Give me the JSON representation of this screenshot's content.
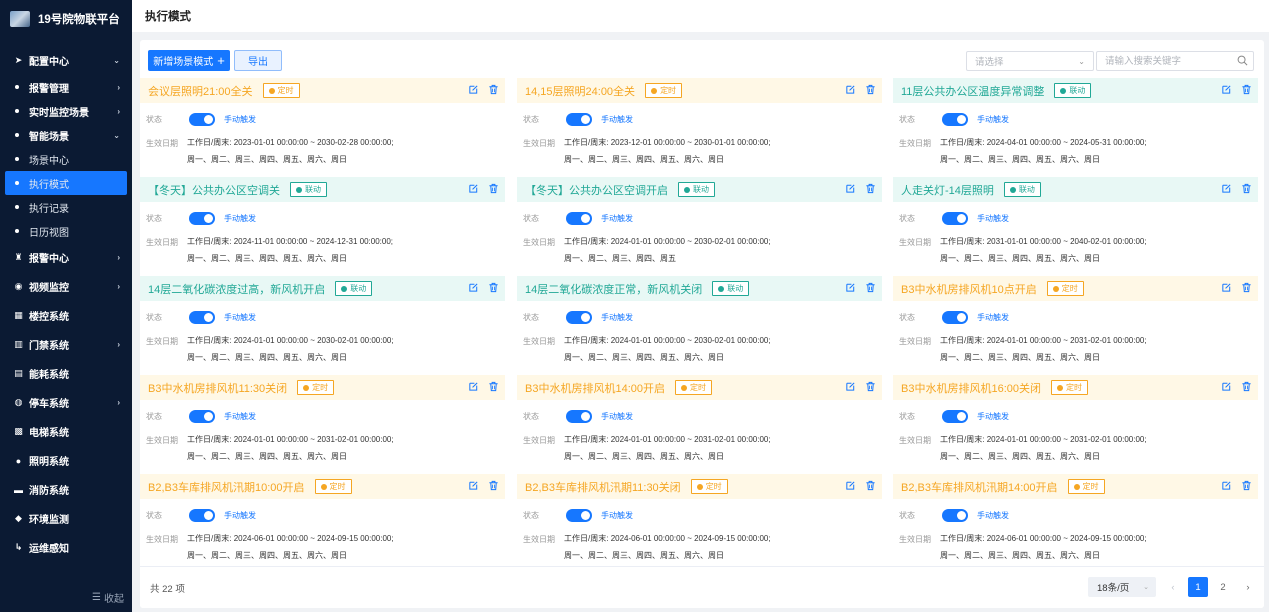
{
  "app": {
    "title": "19号院物联平台"
  },
  "sidebar": {
    "items": [
      {
        "type": "group",
        "label": "配置中心",
        "icon": "send-icon",
        "expanded": true
      },
      {
        "type": "sub",
        "label": "报警管理",
        "arrow": true
      },
      {
        "type": "sub",
        "label": "实时监控场景",
        "arrow": true
      },
      {
        "type": "sub",
        "label": "智能场景",
        "arrow": true,
        "expanded": true
      },
      {
        "type": "leaf",
        "label": "场景中心"
      },
      {
        "type": "leaf",
        "label": "执行模式",
        "active": true
      },
      {
        "type": "leaf",
        "label": "执行记录"
      },
      {
        "type": "leaf",
        "label": "日历视图"
      },
      {
        "type": "group",
        "label": "报警中心",
        "icon": "alarm-icon",
        "arrow": true
      },
      {
        "type": "group",
        "label": "视频监控",
        "icon": "camera-icon",
        "arrow": true
      },
      {
        "type": "group",
        "label": "楼控系统",
        "icon": "building-icon"
      },
      {
        "type": "group",
        "label": "门禁系统",
        "icon": "door-icon",
        "arrow": true
      },
      {
        "type": "group",
        "label": "能耗系统",
        "icon": "energy-icon"
      },
      {
        "type": "group",
        "label": "停车系统",
        "icon": "parking-icon",
        "arrow": true
      },
      {
        "type": "group",
        "label": "电梯系统",
        "icon": "elevator-icon"
      },
      {
        "type": "group",
        "label": "照明系统",
        "icon": "light-icon"
      },
      {
        "type": "group",
        "label": "消防系统",
        "icon": "fire-icon"
      },
      {
        "type": "group",
        "label": "环境监测",
        "icon": "env-icon"
      },
      {
        "type": "group",
        "label": "运维感知",
        "icon": "ops-icon"
      }
    ],
    "collapse_label": "收起"
  },
  "header": {
    "title": "执行模式"
  },
  "toolbar": {
    "add_label": "新增场景模式",
    "export_label": "导出",
    "select_placeholder": "请选择",
    "search_placeholder": "请输入搜索关键字"
  },
  "card_labels": {
    "state": "状态",
    "effective": "生效日期",
    "manual": "手动触发",
    "workday_prefix": "工作日/周末:"
  },
  "cards": [
    {
      "title": "会议层照明21:00全关",
      "type": "timer",
      "tag": "定时",
      "range": "2023-01-01 00:00:00 ~ 2030-02-28 00:00:00;",
      "days": "周一、周二、周三、周四、周五、周六、周日"
    },
    {
      "title": "14,15层照明24:00全关",
      "type": "timer",
      "tag": "定时",
      "range": "2023-12-01 00:00:00 ~ 2030-01-01 00:00:00;",
      "days": "周一、周二、周三、周四、周五、周六、周日"
    },
    {
      "title": "11层公共办公区温度异常调整",
      "type": "link",
      "tag": "联动",
      "range": "2024-04-01 00:00:00 ~ 2024-05-31 00:00:00;",
      "days": "周一、周二、周三、周四、周五、周六、周日"
    },
    {
      "title": "【冬天】公共办公区空调关",
      "type": "link",
      "tag": "联动",
      "range": "2024-11-01 00:00:00 ~ 2024-12-31 00:00:00;",
      "days": "周一、周二、周三、周四、周五、周六、周日"
    },
    {
      "title": "【冬天】公共办公区空调开启",
      "type": "link",
      "tag": "联动",
      "range": "2024-01-01 00:00:00 ~ 2030-02-01 00:00:00;",
      "days": "周一、周二、周三、周四、周五"
    },
    {
      "title": "人走关灯-14层照明",
      "type": "link",
      "tag": "联动",
      "range": "2031-01-01 00:00:00 ~ 2040-02-01 00:00:00;",
      "days": "周一、周二、周三、周四、周五、周六、周日"
    },
    {
      "title": "14层二氧化碳浓度过高，新风机开启",
      "type": "link",
      "tag": "联动",
      "range": "2024-01-01 00:00:00 ~ 2030-02-01 00:00:00;",
      "days": "周一、周二、周三、周四、周五、周六、周日"
    },
    {
      "title": "14层二氧化碳浓度正常，新风机关闭",
      "type": "link",
      "tag": "联动",
      "range": "2024-01-01 00:00:00 ~ 2030-02-01 00:00:00;",
      "days": "周一、周二、周三、周四、周五、周六、周日"
    },
    {
      "title": "B3中水机房排风机10点开启",
      "type": "timer",
      "tag": "定时",
      "range": "2024-01-01 00:00:00 ~ 2031-02-01 00:00:00;",
      "days": "周一、周二、周三、周四、周五、周六、周日"
    },
    {
      "title": "B3中水机房排风机11:30关闭",
      "type": "timer",
      "tag": "定时",
      "range": "2024-01-01 00:00:00 ~ 2031-02-01 00:00:00;",
      "days": "周一、周二、周三、周四、周五、周六、周日"
    },
    {
      "title": "B3中水机房排风机14:00开启",
      "type": "timer",
      "tag": "定时",
      "range": "2024-01-01 00:00:00 ~ 2031-02-01 00:00:00;",
      "days": "周一、周二、周三、周四、周五、周六、周日"
    },
    {
      "title": "B3中水机房排风机16:00关闭",
      "type": "timer",
      "tag": "定时",
      "range": "2024-01-01 00:00:00 ~ 2031-02-01 00:00:00;",
      "days": "周一、周二、周三、周四、周五、周六、周日"
    },
    {
      "title": "B2,B3车库排风机汛期10:00开启",
      "type": "timer",
      "tag": "定时",
      "range": "2024-06-01 00:00:00 ~ 2024-09-15 00:00:00;",
      "days": "周一、周二、周三、周四、周五、周六、周日"
    },
    {
      "title": "B2,B3车库排风机汛期11:30关闭",
      "type": "timer",
      "tag": "定时",
      "range": "2024-06-01 00:00:00 ~ 2024-09-15 00:00:00;",
      "days": "周一、周二、周三、周四、周五、周六、周日"
    },
    {
      "title": "B2,B3车库排风机汛期14:00开启",
      "type": "timer",
      "tag": "定时",
      "range": "2024-06-01 00:00:00 ~ 2024-09-15 00:00:00;",
      "days": "周一、周二、周三、周四、周五、周六、周日"
    }
  ],
  "footer": {
    "total": "共 22 项",
    "page_size": "18条/页",
    "pages": [
      "1",
      "2"
    ],
    "current_page": "1",
    "prev": "‹",
    "next": "›"
  },
  "colors": {
    "primary": "#1677ff",
    "timer": "#f5a623",
    "link": "#21a896",
    "sidebar_bg": "#0b1a33"
  }
}
